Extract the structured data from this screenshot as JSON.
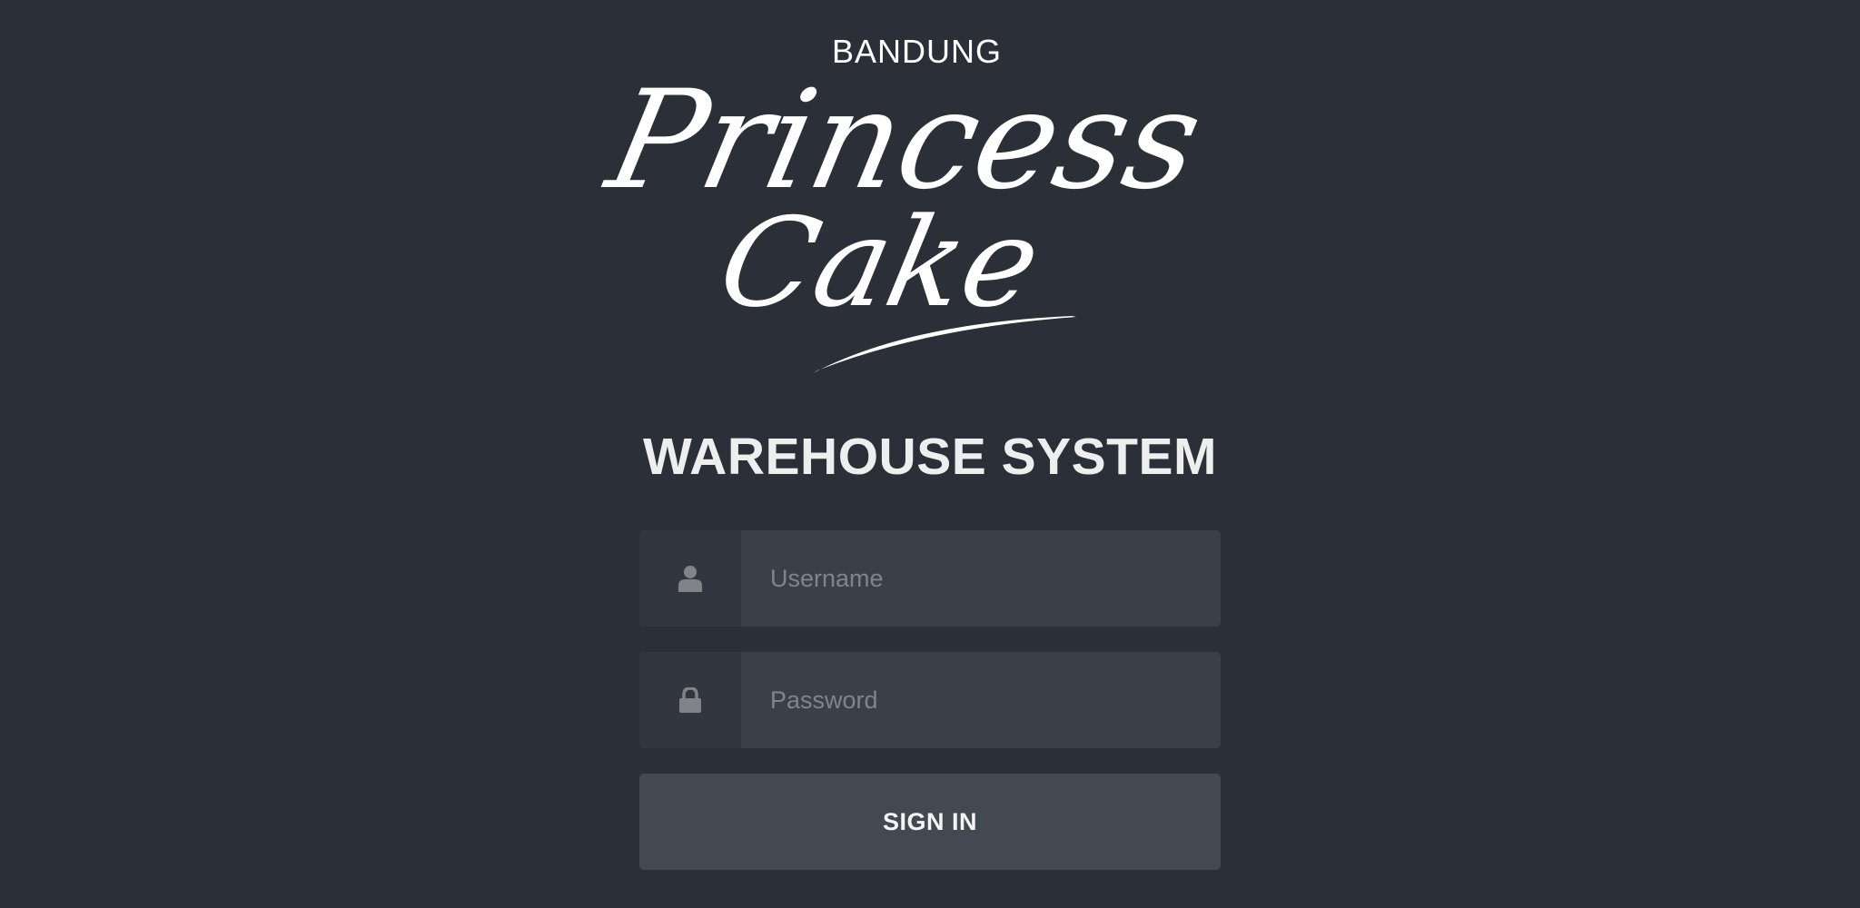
{
  "logo": {
    "top_text": "BANDUNG",
    "line1": "Princess",
    "line2": "Cake"
  },
  "title": "WAREHOUSE SYSTEM",
  "form": {
    "username": {
      "placeholder": "Username",
      "value": "",
      "icon": "user-icon"
    },
    "password": {
      "placeholder": "Password",
      "value": "",
      "icon": "lock-icon"
    },
    "submit_label": "SIGN IN"
  },
  "colors": {
    "background": "#2b3038",
    "input_bg": "#3a4049",
    "addon_bg": "#32373f",
    "button_bg": "#434951",
    "text": "#eeeeee"
  }
}
